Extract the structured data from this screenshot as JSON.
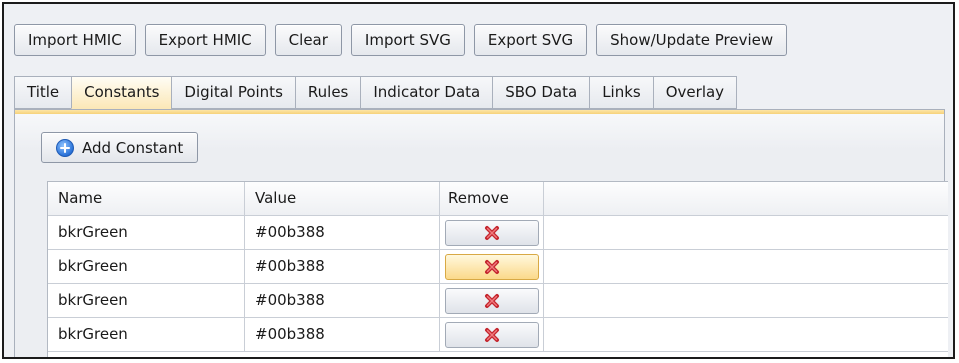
{
  "toolbar": {
    "import_hmic": "Import HMIC",
    "export_hmic": "Export HMIC",
    "clear": "Clear",
    "import_svg": "Import SVG",
    "export_svg": "Export SVG",
    "show_update_preview": "Show/Update Preview"
  },
  "tabs": {
    "active": "Constants",
    "items": [
      "Title",
      "Constants",
      "Digital Points",
      "Rules",
      "Indicator Data",
      "SBO Data",
      "Links",
      "Overlay"
    ]
  },
  "constants_panel": {
    "add_button_label": "Add Constant",
    "add_icon": "add-circle-icon",
    "columns": [
      "Name",
      "Value",
      "Remove"
    ],
    "remove_icon": "red-x-icon",
    "rows": [
      {
        "name": "bkrGreen",
        "value": "#00b388"
      },
      {
        "name": "bkrGreen",
        "value": "#00b388"
      },
      {
        "name": "bkrGreen",
        "value": "#00b388"
      },
      {
        "name": "bkrGreen",
        "value": "#00b388"
      }
    ],
    "hovered_remove_row": 2
  },
  "colors": {
    "active_tab": "#fbe8b8",
    "hover_button": "#fbd98a",
    "remove_x": "#d9363e",
    "add_icon": "#2a72d8"
  }
}
